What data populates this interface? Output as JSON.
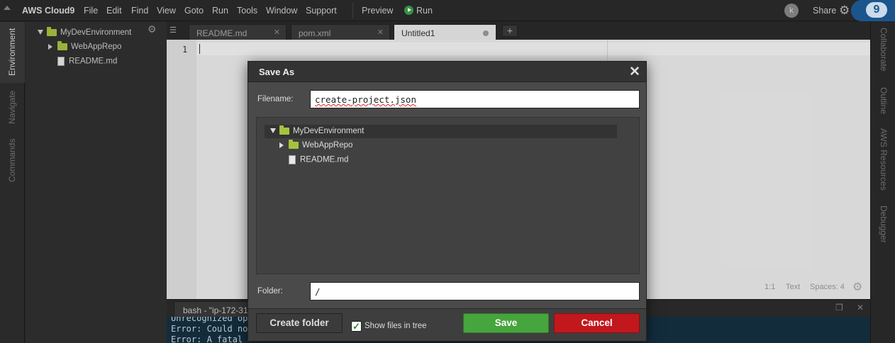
{
  "menubar": {
    "brand": "AWS Cloud9",
    "items": [
      "File",
      "Edit",
      "Find",
      "View",
      "Goto",
      "Run",
      "Tools",
      "Window",
      "Support"
    ],
    "preview": "Preview",
    "run": "Run",
    "avatar_initial": "k",
    "share": "Share",
    "logo_text": "9"
  },
  "left_panel": {
    "tabs": [
      "Environment",
      "Navigate",
      "Commands"
    ]
  },
  "right_panel": {
    "tabs": [
      "Collaborate",
      "Outline",
      "AWS Resources",
      "Debugger"
    ]
  },
  "file_tree": {
    "root": "MyDevEnvironment",
    "children": [
      {
        "label": "WebAppRepo",
        "type": "folder"
      },
      {
        "label": "README.md",
        "type": "file"
      }
    ]
  },
  "editor_tabs": [
    {
      "label": "README.md"
    },
    {
      "label": "pom.xml"
    },
    {
      "label": "Untitled1",
      "active": true
    }
  ],
  "editor": {
    "line_numbers": [
      "1"
    ],
    "status": {
      "position": "1:1",
      "mode": "Text",
      "spaces": "Spaces: 4"
    }
  },
  "terminal": {
    "tab_label": "bash - \"ip-172-31-",
    "lines": [
      "Unrecognized op",
      "Error: Could no",
      "Error: A fatal"
    ]
  },
  "dialog": {
    "title": "Save As",
    "filename_label": "Filename:",
    "filename_value": "create-project.json",
    "tree": {
      "root": "MyDevEnvironment",
      "children": [
        "WebAppRepo",
        "README.md"
      ]
    },
    "folder_label": "Folder:",
    "folder_value": "/",
    "create_folder": "Create folder",
    "show_files": "Show files in tree",
    "save": "Save",
    "cancel": "Cancel"
  },
  "colors": {
    "save_button": "#46a53d",
    "cancel_button": "#c2171d",
    "folder_icon": "#a7c23f",
    "terminal_bg": "#143042",
    "logo_bg": "#1f5d9a"
  }
}
